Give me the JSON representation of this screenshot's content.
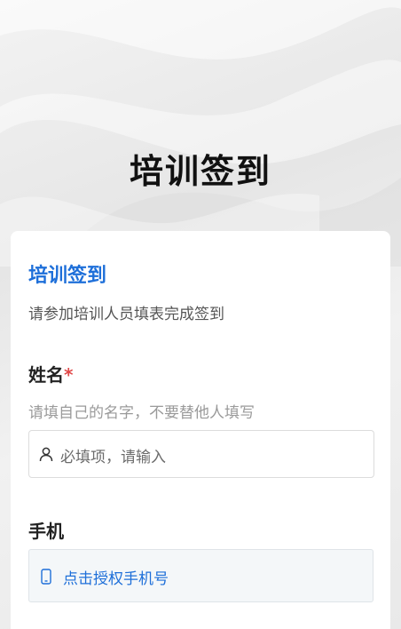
{
  "hero": {
    "title": "培训签到"
  },
  "form": {
    "title": "培训签到",
    "description": "请参加培训人员填表完成签到"
  },
  "name_field": {
    "label": "姓名",
    "required_mark": "*",
    "hint": "请填自己的名字，不要替他人填写",
    "placeholder": "必填项，请输入",
    "icon": "user-icon"
  },
  "phone_field": {
    "label": "手机",
    "button_label": "点击授权手机号",
    "icon": "mobile-phone-icon"
  },
  "colors": {
    "accent": "#1e6fd9",
    "required": "#e04848"
  }
}
